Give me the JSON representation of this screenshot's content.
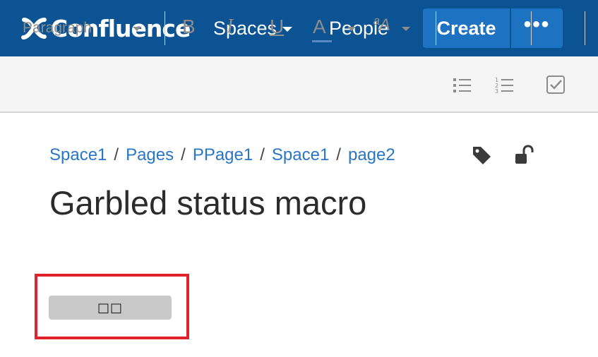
{
  "header": {
    "logo_text": "Confluence",
    "nav_spaces": "Spaces",
    "nav_people": "People",
    "create_label": "Create",
    "more_label": "•••"
  },
  "toolbar": {
    "paragraph_label": "Paragraph",
    "bold_label": "B",
    "italic_label": "I",
    "underline_label": "U",
    "text_color_label": "A",
    "text_style_label": "ªA",
    "icons": [
      "bullet-list-icon",
      "numbered-list-icon",
      "task-list-icon"
    ]
  },
  "breadcrumb": {
    "items": [
      "Space1",
      "Pages",
      "PPage1",
      "Space1",
      "page2"
    ],
    "separator": "/",
    "icons": [
      "tag-icon",
      "unlock-icon"
    ]
  },
  "page": {
    "title": "Garbled status macro"
  },
  "status_macro": {
    "text": "□□",
    "highlight_color": "#e1222b"
  },
  "colors": {
    "header_bg": "#0b5393",
    "create_bg": "#1d72c2",
    "link": "#2a76c6",
    "lozenge_bg": "#c9c9c9"
  }
}
